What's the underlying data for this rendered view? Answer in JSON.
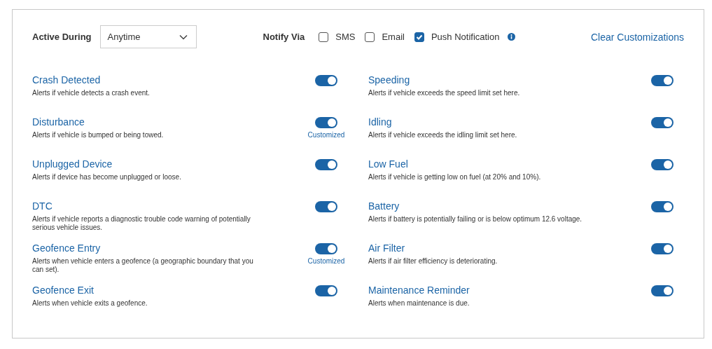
{
  "active_during": {
    "label": "Active During",
    "value": "Anytime"
  },
  "notify_via": {
    "label": "Notify Via",
    "options": [
      {
        "label": "SMS",
        "checked": false
      },
      {
        "label": "Email",
        "checked": false
      },
      {
        "label": "Push Notification",
        "checked": true,
        "info": true
      }
    ]
  },
  "clear_link": "Clear Customizations",
  "columns": [
    [
      {
        "title": "Crash Detected",
        "description": "Alerts if vehicle detects a crash event.",
        "on": true
      },
      {
        "title": "Disturbance",
        "description": "Alerts if vehicle is bumped or being towed.",
        "on": true,
        "badge": "Customized"
      },
      {
        "title": "Unplugged Device",
        "description": "Alerts if device has become unplugged or loose.",
        "on": true
      },
      {
        "title": "DTC",
        "description": "Alerts if vehicle reports a diagnostic trouble code warning of potentially serious vehicle issues.",
        "on": true
      },
      {
        "title": "Geofence Entry",
        "description": "Alerts when vehicle enters a geofence (a geographic boundary that you can set).",
        "on": true,
        "badge": "Customized"
      },
      {
        "title": "Geofence Exit",
        "description": "Alerts when vehicle exits a geofence.",
        "on": true
      }
    ],
    [
      {
        "title": "Speeding",
        "description": "Alerts if vehicle exceeds the speed limit set here.",
        "on": true
      },
      {
        "title": "Idling",
        "description": "Alerts if vehicle exceeds the idling limit set here.",
        "on": true
      },
      {
        "title": "Low Fuel",
        "description": "Alerts if vehicle is getting low on fuel (at 20% and 10%).",
        "on": true
      },
      {
        "title": "Battery",
        "description": "Alerts if battery is potentially failing or is below optimum 12.6 voltage.",
        "on": true
      },
      {
        "title": "Air Filter",
        "description": "Alerts if air filter efficiency is deteriorating.",
        "on": true
      },
      {
        "title": "Maintenance Reminder",
        "description": "Alerts when maintenance is due.",
        "on": true
      }
    ]
  ]
}
